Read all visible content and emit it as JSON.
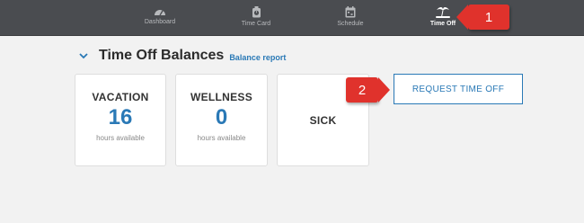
{
  "nav": {
    "items": [
      {
        "label": "Dashboard",
        "icon": "dashboard-gauge-icon"
      },
      {
        "label": "Time Card",
        "icon": "stopwatch-icon"
      },
      {
        "label": "Schedule",
        "icon": "calendar-icon"
      },
      {
        "label": "Time Off",
        "icon": "palm-tree-icon",
        "active": true
      }
    ]
  },
  "callouts": {
    "one": "1",
    "two": "2"
  },
  "section": {
    "title": "Time Off Balances",
    "link": "Balance report"
  },
  "cards": [
    {
      "label": "VACATION",
      "value": "16",
      "sub": "hours available"
    },
    {
      "label": "WELLNESS",
      "value": "0",
      "sub": "hours available"
    },
    {
      "label": "SICK"
    }
  ],
  "request_button": {
    "label": "REQUEST TIME OFF"
  },
  "colors": {
    "nav_bg": "#4a4c50",
    "accent": "#2a79b6",
    "callout": "#e0322c",
    "page_bg": "#f2f2f2"
  }
}
